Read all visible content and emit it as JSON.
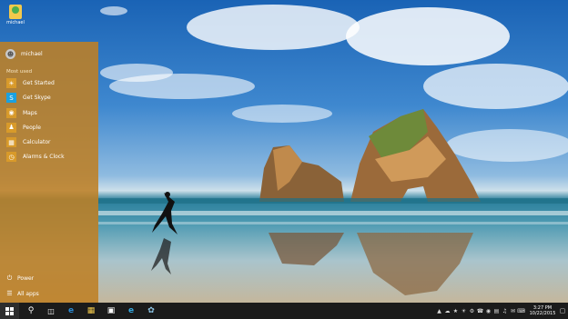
{
  "desktop": {
    "icon_label": "michael"
  },
  "start_menu": {
    "user_name": "michael",
    "section_label": "Most used",
    "items": [
      {
        "label": "Get Started",
        "icon": "lightbulb-icon",
        "color": "#d89a2a"
      },
      {
        "label": "Get Skype",
        "icon": "skype-icon",
        "color": "#1aa1e0"
      },
      {
        "label": "Maps",
        "icon": "maps-icon",
        "color": "#d89a2a"
      },
      {
        "label": "People",
        "icon": "people-icon",
        "color": "#d89a2a"
      },
      {
        "label": "Calculator",
        "icon": "calculator-icon",
        "color": "#d89a2a"
      },
      {
        "label": "Alarms & Clock",
        "icon": "alarm-clock-icon",
        "color": "#d89a2a"
      }
    ],
    "power_label": "Power",
    "all_apps_label": "All apps"
  },
  "taskbar": {
    "time": "3:27 PM",
    "date": "10/22/2015",
    "accent": "#be8024"
  }
}
